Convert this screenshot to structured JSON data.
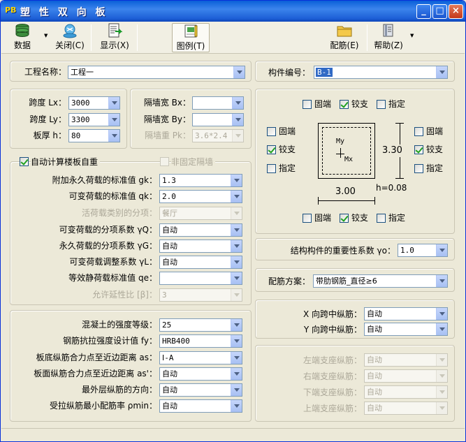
{
  "window": {
    "logo": "PB",
    "title": "塑 性 双 向 板",
    "min_glyph": "_",
    "max_glyph": "□",
    "close_glyph": "×"
  },
  "toolbar": {
    "data_label": "数据",
    "close_label": "关闭(C)",
    "display_label": "显示(X)",
    "legend_label": "图例(T)",
    "rebar_label": "配筋(E)",
    "help_label": "帮助(Z)"
  },
  "project": {
    "name_label": "工程名称：",
    "name_value": "工程一",
    "member_label": "构件编号：",
    "member_value": "B-1"
  },
  "dims": {
    "lx_label": "跨度 Lx：",
    "lx_value": "3000",
    "ly_label": "跨度 Ly：",
    "ly_value": "3300",
    "h_label": "板厚 h：",
    "h_value": "80"
  },
  "wall": {
    "bx_label": "隔墙宽 Bx：",
    "bx_value": "",
    "by_label": "隔墙宽 By：",
    "by_value": "",
    "pk_label": "隔墙重 Pk：",
    "pk_value": "3.6*2.4"
  },
  "supports": {
    "fixed": "固端",
    "pinned": "铰支",
    "specified": "指定",
    "my_label": "My",
    "mx_label": "Mx",
    "dim_y": "3.30",
    "dim_x": "3.00",
    "dim_h": "h=0.08"
  },
  "loads": {
    "auto_weight_label": "自动计算楼板自重",
    "non_fixed_wall_label": "非固定隔墙",
    "gk_label": "附加永久荷载的标准值 gk：",
    "gk_value": "1.3",
    "qk_label": "可变荷载的标准值 qk：",
    "qk_value": "2.0",
    "live_cat_label": "活荷载类别的分项：",
    "live_cat_value": "餐厅",
    "yq_label": "可变荷载的分项系数 γQ：",
    "yq_value": "自动",
    "yg_label": "永久荷载的分项系数 γG：",
    "yg_value": "自动",
    "yl_label": "可变荷载调整系数 γL：",
    "yl_value": "自动",
    "qe_label": "等效静荷载标准值 qe：",
    "qe_value": "",
    "beta_label": "允许延性比 [β]：",
    "beta_value": "3"
  },
  "importance": {
    "label": "结构构件的重要性系数 γo：",
    "value": "1.0"
  },
  "rebar_scheme": {
    "label": "配筋方案：",
    "value": "带肋钢筋_直径≥6"
  },
  "material": {
    "concrete_label": "混凝土的强度等级：",
    "concrete_value": "25",
    "fy_label": "钢筋抗拉强度设计值 fy：",
    "fy_value": "HRB400",
    "as_label": "板底纵筋合力点至近边距离 as：",
    "as_value": "Ⅰ-A",
    "as2_label": "板面纵筋合力点至近边距离 as'：",
    "as2_value": "自动",
    "dir_label": "最外层纵筋的方向：",
    "dir_value": "自动",
    "pmin_label": "受拉纵筋最小配筋率 ρmin：",
    "pmin_value": "自动"
  },
  "midspan": {
    "x_label": "X 向跨中纵筋：",
    "x_value": "自动",
    "y_label": "Y 向跨中纵筋：",
    "y_value": "自动"
  },
  "edge": {
    "left_label": "左端支座纵筋：",
    "left_value": "自动",
    "right_label": "右端支座纵筋：",
    "right_value": "自动",
    "bottom_label": "下端支座纵筋：",
    "bottom_value": "自动",
    "top_label": "上端支座纵筋：",
    "top_value": "自动"
  }
}
